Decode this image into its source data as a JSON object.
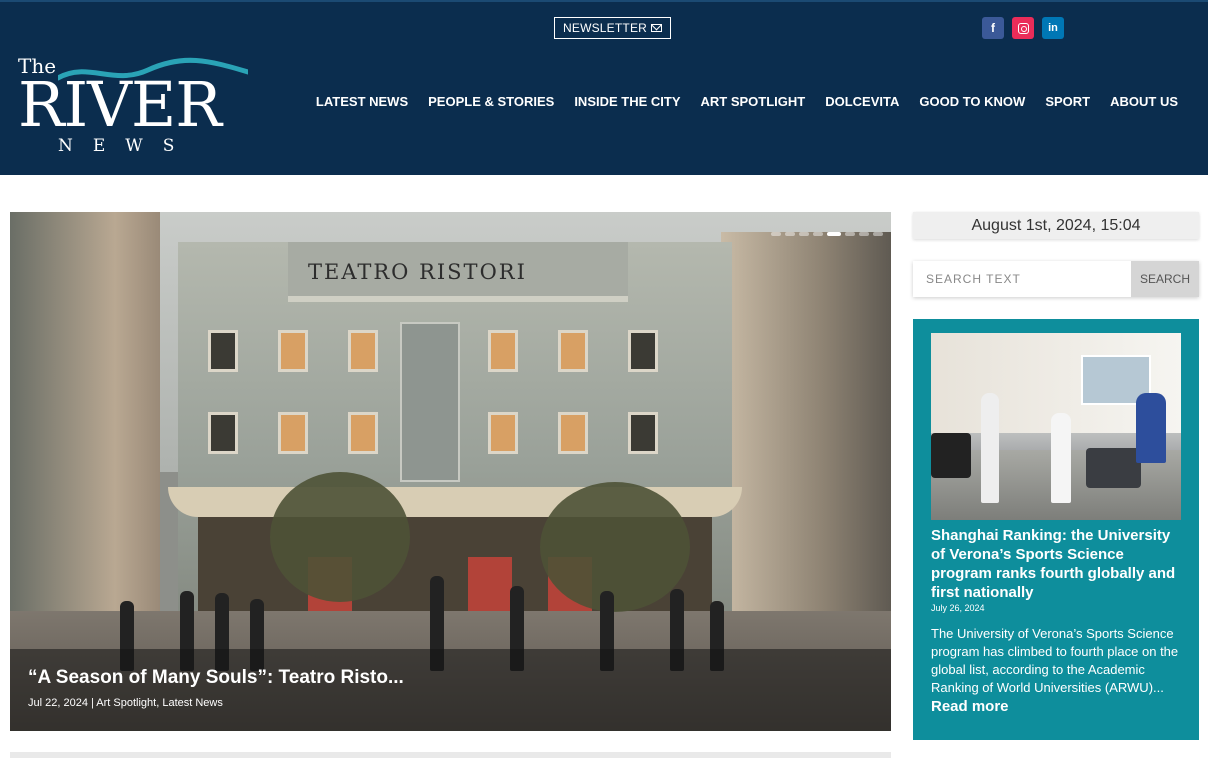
{
  "header": {
    "newsletter_label": "NEWSLETTER",
    "socials": [
      {
        "name": "facebook",
        "glyph": "f",
        "color": "#3b5998"
      },
      {
        "name": "instagram",
        "glyph": "",
        "color": "#ea2c59"
      },
      {
        "name": "linkedin",
        "glyph": "in",
        "color": "#0077b5"
      }
    ],
    "logo": {
      "the": "The",
      "river": "RIVER",
      "news": "NEWS"
    },
    "nav": [
      "LATEST NEWS",
      "PEOPLE & STORIES",
      "INSIDE THE CITY",
      "ART SPOTLIGHT",
      "DOLCEVITA",
      "GOOD TO KNOW",
      "SPORT",
      "ABOUT US"
    ],
    "background_color": "#0b2d4e"
  },
  "slider": {
    "building_sign": "TEATRO RISTORI",
    "title": "“A Season of Many Souls”: Teatro Risto...",
    "meta": "Jul 22, 2024 | Art Spotlight, Latest News",
    "dot_count": 8,
    "active_dot": 4
  },
  "sidebar": {
    "datetime": "August 1st, 2024, 15:04",
    "search": {
      "placeholder": "SEARCH TEXT",
      "button_label": "SEARCH"
    },
    "card": {
      "title": "Shanghai Ranking: the University of Verona’s Sports Science program ranks fourth globally and first nationally",
      "date": "July 26, 2024",
      "excerpt": "The University of Verona’s Sports Science program has climbed to fourth place on the global list, according to the Academic Ranking of World Universities (ARWU)...",
      "read_more": "Read more",
      "background_color": "#0e8e9c"
    }
  }
}
